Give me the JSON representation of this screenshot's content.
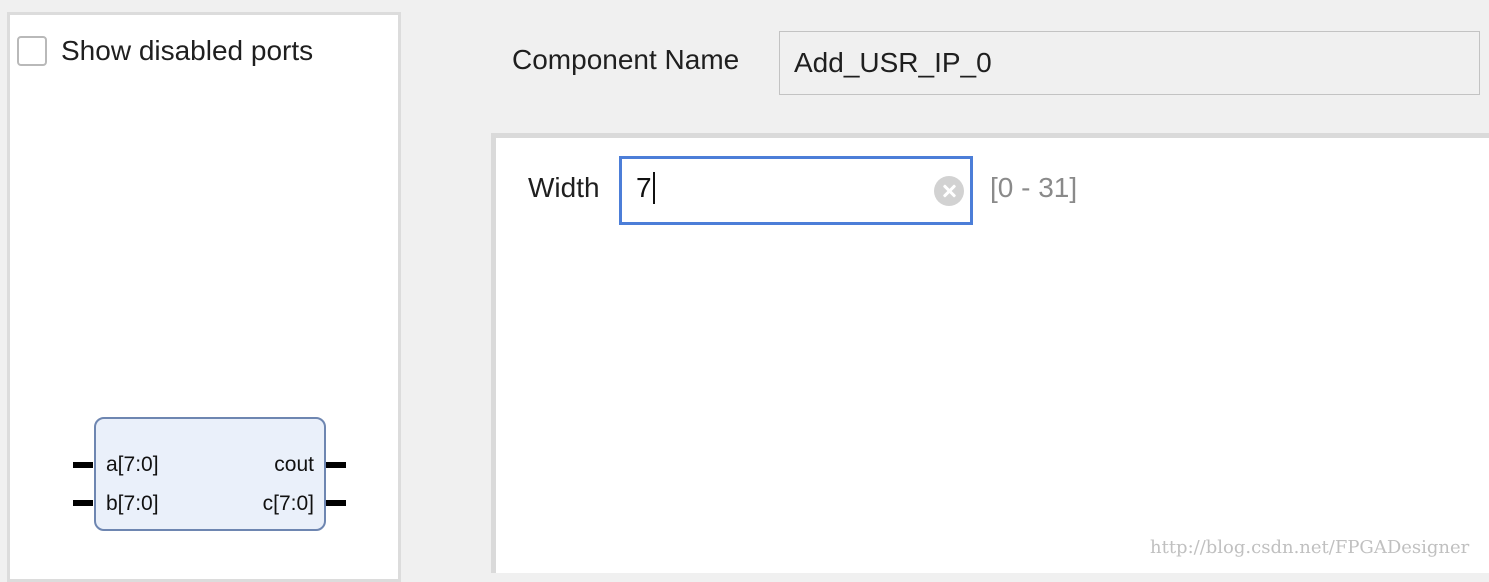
{
  "preview": {
    "show_disabled_ports_label": "Show disabled ports",
    "show_disabled_ports_checked": false,
    "ip_symbol": {
      "ports_left": [
        "a[7:0]",
        "b[7:0]"
      ],
      "ports_right": [
        "cout",
        "c[7:0]"
      ]
    }
  },
  "component": {
    "label": "Component Name",
    "value": "Add_USR_IP_0"
  },
  "params": {
    "width_label": "Width",
    "width_value": "7",
    "width_range": "[0 - 31]"
  },
  "watermark": "http://blog.csdn.net/FPGADesigner",
  "colors": {
    "focus_border": "#4c7ed8",
    "ip_block_fill": "#eaf0fa",
    "ip_block_border": "#6e86b1"
  }
}
